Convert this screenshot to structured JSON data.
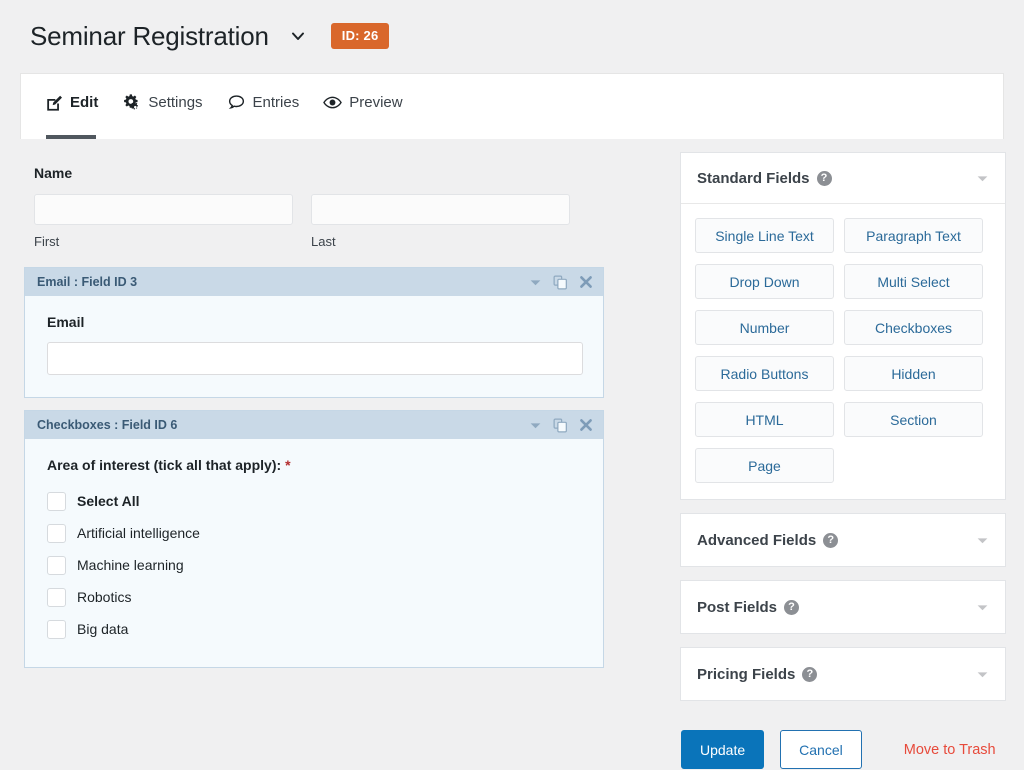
{
  "header": {
    "form_title": "Seminar Registration",
    "title_chevron_icon": "chevron-down-icon",
    "id_badge": "ID: 26"
  },
  "tabs": [
    {
      "label": "Edit",
      "icon": "pencil-square-icon",
      "active": true
    },
    {
      "label": "Settings",
      "icon": "gears-icon",
      "active": false
    },
    {
      "label": "Entries",
      "icon": "speech-bubble-icon",
      "active": false
    },
    {
      "label": "Preview",
      "icon": "eye-icon",
      "active": false
    }
  ],
  "editor": {
    "name_field": {
      "label": "Name",
      "first_sub_label": "First",
      "last_sub_label": "Last",
      "first_value": "",
      "last_value": ""
    },
    "email_field": {
      "panel_title": "Email : Field ID 3",
      "label": "Email",
      "value": "",
      "tools": [
        "chevron-down-icon",
        "duplicate-icon",
        "close-icon"
      ]
    },
    "checkbox_field": {
      "panel_title": "Checkboxes : Field ID 6",
      "label": "Area of interest (tick all that apply):",
      "required_marker": "*",
      "tools": [
        "chevron-down-icon",
        "duplicate-icon",
        "close-icon"
      ],
      "choices": [
        {
          "label": "Select All",
          "checked": false,
          "bold": true
        },
        {
          "label": "Artificial intelligence",
          "checked": false,
          "bold": false
        },
        {
          "label": "Machine learning",
          "checked": false,
          "bold": false
        },
        {
          "label": "Robotics",
          "checked": false,
          "bold": false
        },
        {
          "label": "Big data",
          "checked": false,
          "bold": false
        }
      ]
    }
  },
  "sidebar": {
    "panels": [
      {
        "title": "Standard Fields",
        "help_icon": "help-circle-icon",
        "toggle_icon": "caret-down-icon",
        "expanded": true,
        "buttons": [
          "Single Line Text",
          "Paragraph Text",
          "Drop Down",
          "Multi Select",
          "Number",
          "Checkboxes",
          "Radio Buttons",
          "Hidden",
          "HTML",
          "Section",
          "Page"
        ]
      },
      {
        "title": "Advanced Fields",
        "help_icon": "help-circle-icon",
        "toggle_icon": "caret-down-icon",
        "expanded": false,
        "buttons": []
      },
      {
        "title": "Post Fields",
        "help_icon": "help-circle-icon",
        "toggle_icon": "caret-down-icon",
        "expanded": false,
        "buttons": []
      },
      {
        "title": "Pricing Fields",
        "help_icon": "help-circle-icon",
        "toggle_icon": "caret-down-icon",
        "expanded": false,
        "buttons": []
      }
    ],
    "actions": {
      "update_label": "Update",
      "cancel_label": "Cancel",
      "trash_label": "Move to Trash"
    }
  },
  "colors": {
    "page_background": "#f0f0f1",
    "badge_orange": "#d9672b",
    "primary_blue": "#0a74ba",
    "link_blue": "#2271b1",
    "field_button_text": "#2b6a99",
    "panel_header_blue": "#c9d9e7",
    "panel_title_text": "#3a5a75",
    "panel_body_blue": "#f5fafd",
    "danger_red": "#e74a3b",
    "required_red": "#b32d2e"
  }
}
